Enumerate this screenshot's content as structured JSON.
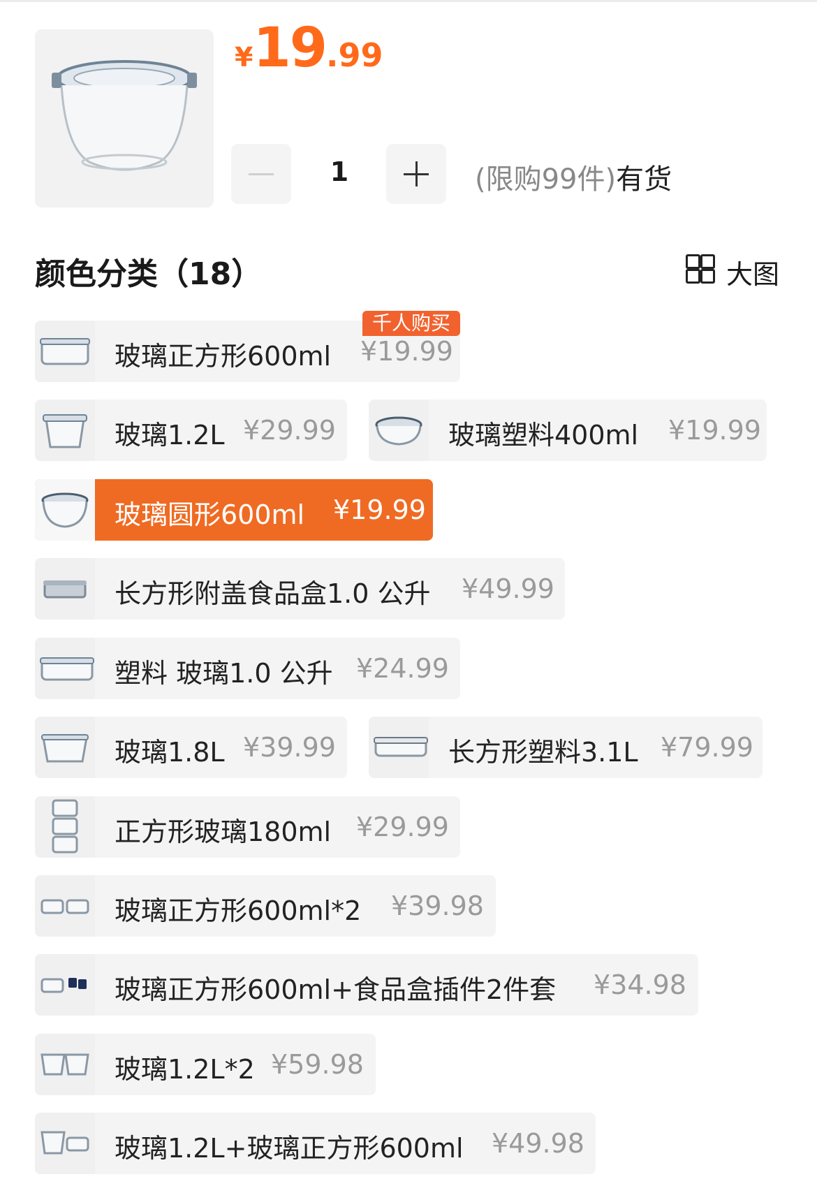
{
  "product": {
    "price_currency": "¥",
    "price_int": "19",
    "price_dec": ".99"
  },
  "quantity": {
    "value": "1",
    "limit_text": "(限购99件)",
    "stock_text": "有货"
  },
  "section": {
    "title": "颜色分类（18）",
    "big_view_label": "大图"
  },
  "badge": "千人购买",
  "options": [
    {
      "name": "玻璃正方形600ml",
      "price": "¥19.99",
      "selected": false
    },
    {
      "name": "玻璃1.2L",
      "price": "¥29.99",
      "selected": false
    },
    {
      "name": "玻璃塑料400ml",
      "price": "¥19.99",
      "selected": false
    },
    {
      "name": "玻璃圆形600ml",
      "price": "¥19.99",
      "selected": true
    },
    {
      "name": "长方形附盖食品盒1.0 公升",
      "price": "¥49.99",
      "selected": false
    },
    {
      "name": "塑料 玻璃1.0 公升",
      "price": "¥24.99",
      "selected": false
    },
    {
      "name": "玻璃1.8L",
      "price": "¥39.99",
      "selected": false
    },
    {
      "name": "长方形塑料3.1L",
      "price": "¥79.99",
      "selected": false
    },
    {
      "name": "正方形玻璃180ml",
      "price": "¥29.99",
      "selected": false
    },
    {
      "name": "玻璃正方形600ml*2",
      "price": "¥39.98",
      "selected": false
    },
    {
      "name": "玻璃正方形600ml+食品盒插件2件套",
      "price": "¥34.98",
      "selected": false
    },
    {
      "name": "玻璃1.2L*2",
      "price": "¥59.98",
      "selected": false
    },
    {
      "name": "玻璃1.2L+玻璃正方形600ml",
      "price": "¥49.98",
      "selected": false
    }
  ]
}
